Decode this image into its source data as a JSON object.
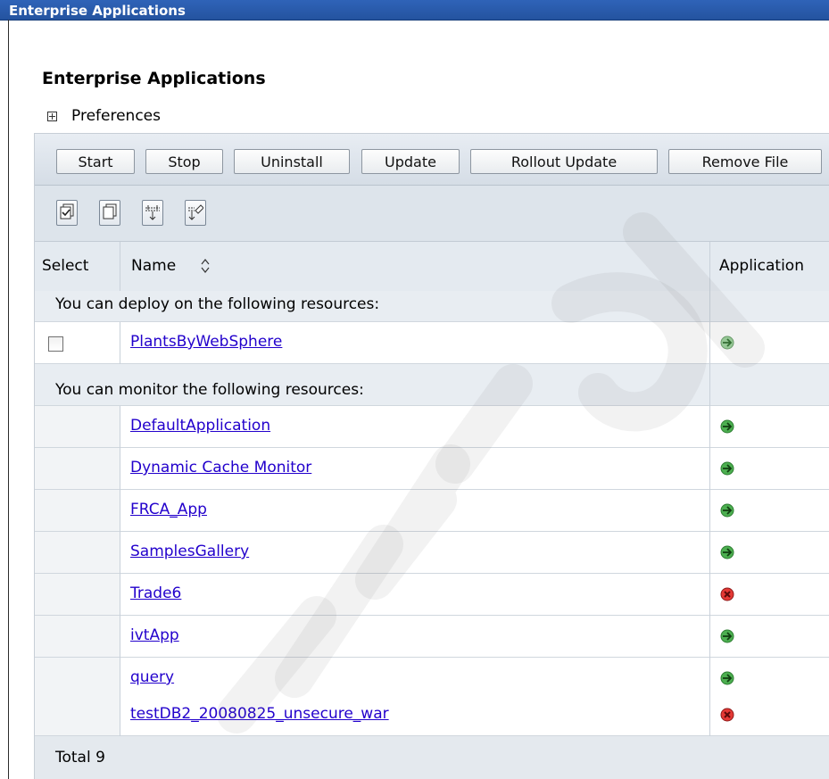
{
  "window": {
    "title": "Enterprise Applications"
  },
  "page": {
    "title": "Enterprise Applications"
  },
  "preferences": {
    "label": "Preferences"
  },
  "toolbar": {
    "buttons": [
      "Start",
      "Stop",
      "Uninstall",
      "Update",
      "Rollout Update",
      "Remove File"
    ],
    "icons": [
      "select-all-icon",
      "deselect-all-icon",
      "show-filter-icon",
      "clear-filter-icon"
    ]
  },
  "table": {
    "headers": {
      "select": "Select",
      "name": "Name",
      "sort_icon": "sort-arrows-icon",
      "application": "Application"
    },
    "groups": [
      {
        "label": "You can deploy on the following resources:"
      },
      {
        "label": "You can monitor the following resources:"
      }
    ],
    "rows": [
      {
        "name": "PlantsByWebSphere",
        "status": "partial-started",
        "group": 0,
        "selectable": true
      },
      {
        "name": "DefaultApplication",
        "status": "started",
        "group": 1
      },
      {
        "name": "Dynamic Cache Monitor",
        "status": "started",
        "group": 1
      },
      {
        "name": "FRCA_App",
        "status": "started",
        "group": 1
      },
      {
        "name": "SamplesGallery",
        "status": "started",
        "group": 1
      },
      {
        "name": "Trade6",
        "status": "stopped",
        "group": 1
      },
      {
        "name": "ivtApp",
        "status": "started",
        "group": 1
      },
      {
        "name": "query",
        "status": "started",
        "group": 1
      },
      {
        "name": "testDB2_20080825_unsecure_war",
        "status": "stopped",
        "group": 1
      }
    ],
    "footer": "Total 9"
  },
  "colors": {
    "titlebar": "#2f63b8",
    "link": "#2200cc",
    "status_started": "#2e9a3a",
    "status_partial": "#7fbf7f",
    "status_stopped": "#cc2222"
  }
}
